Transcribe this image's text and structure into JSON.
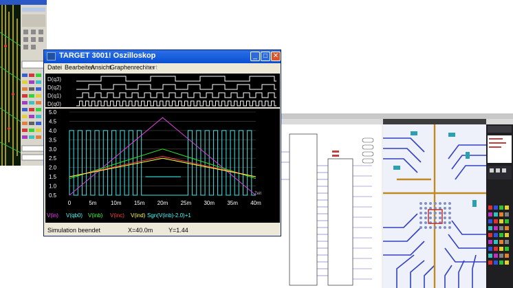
{
  "window": {
    "title": "TARGET 3001! Oszilloskop",
    "minimize_glyph": "_",
    "maximize_glyph": "□",
    "close_glyph": "✕"
  },
  "menu": {
    "items": [
      "Datei",
      "Bearbeiten",
      "Ansicht",
      "Graphenrechner",
      "Start"
    ],
    "start_enabled": false
  },
  "digital": {
    "labels": [
      "D(q3)",
      "D(q2)",
      "D(q1)",
      "D(q0)"
    ]
  },
  "analog": {
    "y_ticks": [
      "5.0",
      "4.5",
      "4.0",
      "3.5",
      "3.0",
      "2.5",
      "2.0",
      "1.5",
      "1.0",
      "0.5"
    ],
    "x_ticks": [
      "0",
      "5m",
      "10m",
      "15m",
      "20m",
      "25m",
      "30m",
      "35m",
      "40m"
    ],
    "zeit_label": "Zeit",
    "legend": [
      {
        "label": "V(in)",
        "color": "#ff40ff"
      },
      {
        "label": "V(qb0)",
        "color": "#40ffff"
      },
      {
        "label": "V(inb)",
        "color": "#40ff40"
      },
      {
        "label": "V(inc)",
        "color": "#ff4040"
      },
      {
        "label": "V(ind)",
        "color": "#ffff40"
      },
      {
        "label": "Sgn(V(inb)-2.0)+1",
        "color": "#40ffff"
      }
    ]
  },
  "status": {
    "message": "Simulation beendet",
    "x_readout": "X=40.0m",
    "y_readout": "Y=1.44"
  },
  "chart_data": {
    "type": "line",
    "x_unit": "s",
    "xlim": [
      0,
      0.04
    ],
    "ylim": [
      0.5,
      5.0
    ],
    "series": [
      {
        "name": "V(in)",
        "x": [
          0,
          0.02,
          0.04
        ],
        "y": [
          0.5,
          4.7,
          0.5
        ]
      },
      {
        "name": "V(inb)",
        "x": [
          0,
          0.02,
          0.04
        ],
        "y": [
          1.4,
          3.0,
          1.4
        ]
      },
      {
        "name": "V(inc)",
        "x": [
          0,
          0.02,
          0.04
        ],
        "y": [
          1.5,
          2.6,
          1.5
        ]
      },
      {
        "name": "V(ind)",
        "x": [
          0,
          0.02,
          0.04
        ],
        "y": [
          1.5,
          2.5,
          1.5
        ]
      },
      {
        "name": "V(qb0)",
        "x": [
          0,
          0.04
        ],
        "y": [
          0.5,
          4.0
        ],
        "square_low": 0.5,
        "square_high": 4.0
      }
    ]
  }
}
